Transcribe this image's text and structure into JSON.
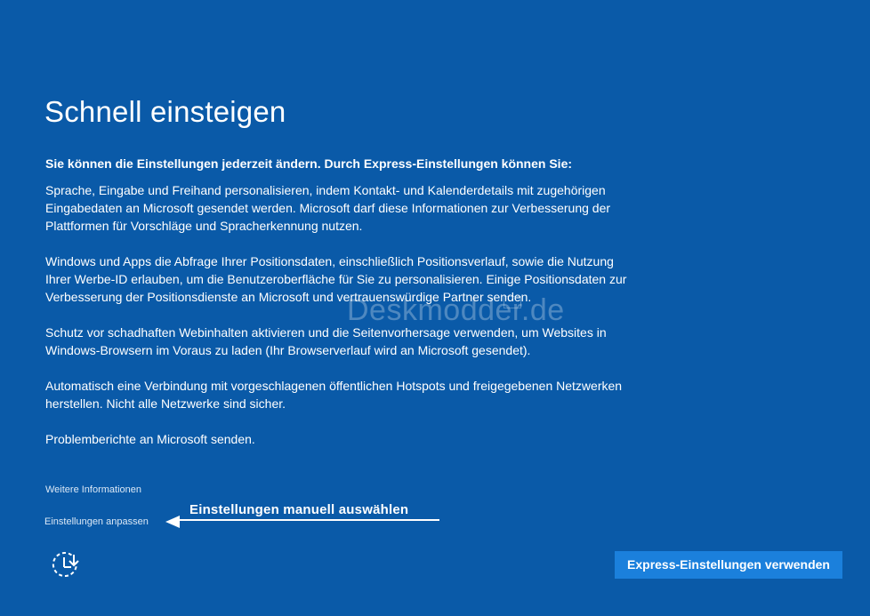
{
  "page": {
    "title": "Schnell einsteigen",
    "intro": "Sie können die Einstellungen jederzeit ändern. Durch Express-Einstellungen können Sie:",
    "paragraphs": [
      "Sprache, Eingabe und Freihand personalisieren, indem Kontakt- und Kalenderdetails mit zugehörigen Eingabedaten an Microsoft gesendet werden. Microsoft darf diese Informationen zur Verbesserung der Plattformen für Vorschläge und Spracherkennung nutzen.",
      "Windows und Apps die Abfrage Ihrer Positionsdaten, einschließlich Positionsverlauf, sowie die Nutzung Ihrer Werbe-ID erlauben, um die Benutzeroberfläche für Sie zu personalisieren. Einige Positionsdaten zur Verbesserung der Positionsdienste an Microsoft und vertrauenswürdige Partner senden.",
      "Schutz vor schadhaften Webinhalten aktivieren und die Seitenvorhersage verwenden, um Websites in Windows-Browsern im Voraus zu laden (Ihr Browserverlauf wird an Microsoft gesendet).",
      "Automatisch eine Verbindung mit vorgeschlagenen öffentlichen Hotspots und freigegebenen Netzwerken herstellen. Nicht alle Netzwerke sind sicher.",
      "Problemberichte an Microsoft senden."
    ]
  },
  "links": {
    "more_info": "Weitere Informationen",
    "customize": "Einstellungen anpassen"
  },
  "annotation": {
    "text": "Einstellungen manuell auswählen"
  },
  "watermark": {
    "text": "Deskmodder.de"
  },
  "buttons": {
    "express": "Express-Einstellungen verwenden"
  },
  "icons": {
    "accessibility": "ease-of-access-icon",
    "arrow": "left-arrow-icon"
  },
  "colors": {
    "background": "#0a5aa8",
    "button": "#1b80dc",
    "text": "#ffffff"
  }
}
